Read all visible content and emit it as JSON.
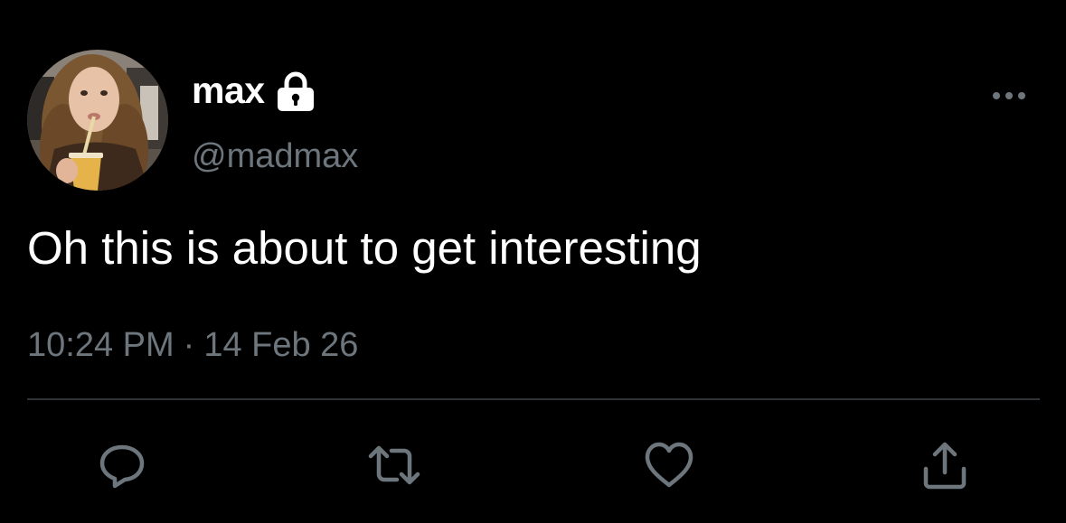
{
  "tweet": {
    "author": {
      "display_name": "max",
      "handle": "@madmax",
      "protected_icon": "lock-icon",
      "avatar": "profile-photo"
    },
    "more_icon": "more-horizontal-icon",
    "text": "Oh this is about to get interesting",
    "time": "10:24 PM",
    "separator": "·",
    "date": "14 Feb 26",
    "actions": [
      {
        "name": "reply",
        "icon": "reply-icon"
      },
      {
        "name": "retweet",
        "icon": "retweet-icon"
      },
      {
        "name": "like",
        "icon": "heart-icon"
      },
      {
        "name": "share",
        "icon": "share-icon"
      }
    ]
  },
  "colors": {
    "background": "#000000",
    "primary_text": "#ffffff",
    "secondary_text": "#6e767d",
    "divider": "#2f3336",
    "icon": "#6e767d"
  }
}
